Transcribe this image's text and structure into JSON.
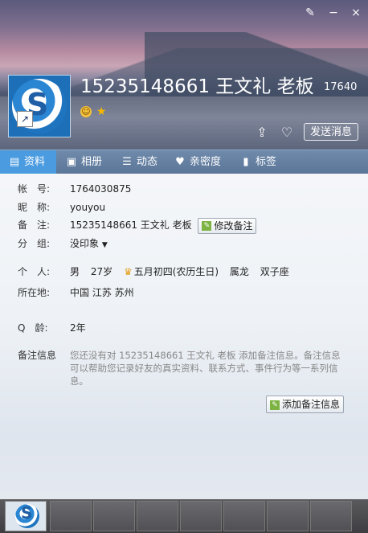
{
  "window": {
    "skin_icon": "brush-icon",
    "minimize_icon": "minimize-icon",
    "close_icon": "close-icon",
    "minimize_glyph": "−",
    "close_glyph": "×",
    "skin_glyph": "✎"
  },
  "header": {
    "title": "15235148661 王文礼 老板",
    "qq_number_partial": "17640",
    "send_button": "发送消息"
  },
  "tabs": [
    {
      "label": "资料",
      "icon": "profile-card-icon",
      "active": true
    },
    {
      "label": "相册",
      "icon": "album-icon",
      "active": false
    },
    {
      "label": "动态",
      "icon": "feed-list-icon",
      "active": false
    },
    {
      "label": "亲密度",
      "icon": "heart-icon",
      "active": false
    },
    {
      "label": "标签",
      "icon": "bookmark-icon",
      "active": false
    }
  ],
  "profile": {
    "account_label": "帐　号:",
    "account_value": "1764030875",
    "nickname_label": "昵　称:",
    "nickname_value": "youyou",
    "remark_label": "备　注:",
    "remark_value": "15235148661 王文礼 老板",
    "edit_remark_button": "修改备注",
    "group_label": "分　组:",
    "group_value": "没印象",
    "personal_label": "个　人:",
    "gender": "男",
    "age": "27岁",
    "birthday": "五月初四(农历生日)",
    "zodiac": "属龙",
    "constellation": "双子座",
    "location_label": "所在地:",
    "location_value": "中国 江苏 苏州",
    "qage_label": "Q　龄:",
    "qage_value": "2年",
    "remark_info_label": "备注信息",
    "remark_info_hint": "您还没有对 15235148661 王文礼 老板 添加备注信息。备注信息可以帮助您记录好友的真实资料、联系方式、事件行为等一系列信息。",
    "add_remark_button": "添加备注信息"
  }
}
